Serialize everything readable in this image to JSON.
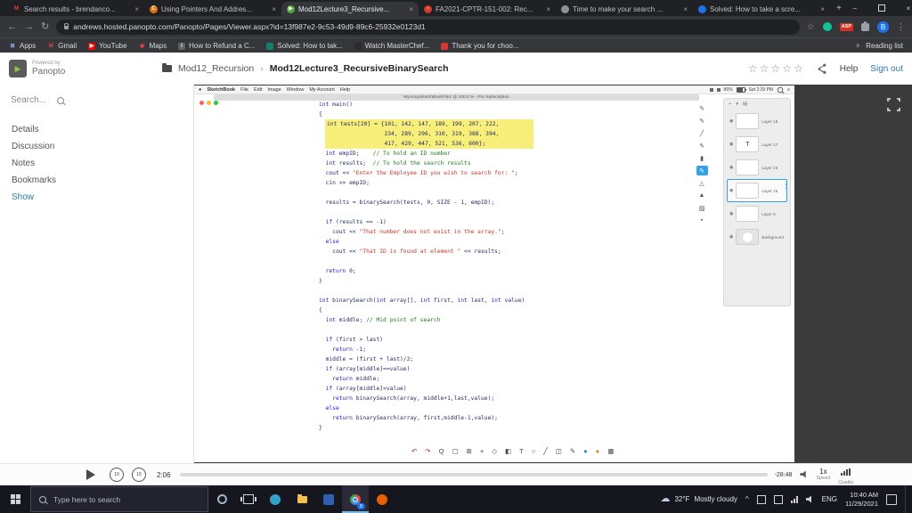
{
  "browser": {
    "tabs": [
      {
        "title": "Search results - brendanco...",
        "fav": {
          "bg": "transparent",
          "fg": "#ea4335",
          "g": "M"
        },
        "active": false
      },
      {
        "title": "Using Pointers And Addres...",
        "fav": {
          "bg": "#e8710a",
          "fg": "#ffffff",
          "g": "C"
        },
        "active": false
      },
      {
        "title": "Mod12Lecture3_Recursive...",
        "fav": {
          "bg": "#4ea93b",
          "fg": "#ffffff",
          "g": "▶"
        },
        "active": true
      },
      {
        "title": "FA2021-CPTR-151-002: Rec...",
        "fav": {
          "bg": "#d0382e",
          "fg": "#ffffff",
          "g": "○"
        },
        "active": false
      },
      {
        "title": "Time to make your search ...",
        "fav": {
          "bg": "#8d9297",
          "fg": "#ffffff",
          "g": ""
        },
        "active": false
      },
      {
        "title": "Solved: How to take a scre...",
        "fav": {
          "bg": "#1a73e8",
          "fg": "#ffffff",
          "g": ""
        },
        "active": false
      }
    ],
    "new_tab": "+",
    "window_controls": {
      "minimize": "–",
      "close": "×"
    },
    "nav": {
      "back": "←",
      "forward": "→",
      "reload": "↻"
    },
    "url": "andrews.hosted.panopto.com/Panopto/Pages/Viewer.aspx?id=13f987e2-9c53-49d9-89c6-25932e0123d1",
    "extensions_badge": "ASP",
    "profile_initial": "B",
    "menu_glyph": "⋮",
    "bookmarks": [
      {
        "label": "Apps",
        "fav": {
          "bg": "transparent",
          "fg": "#8ab4f8",
          "g": "⊞"
        }
      },
      {
        "label": "Gmail",
        "fav": {
          "bg": "transparent",
          "fg": "#ea4335",
          "g": "M"
        }
      },
      {
        "label": "YouTube",
        "fav": {
          "bg": "#ff0000",
          "fg": "#ffffff",
          "g": "▶"
        }
      },
      {
        "label": "Maps",
        "fav": {
          "bg": "transparent",
          "fg": "#ea4335",
          "g": "◉"
        }
      },
      {
        "label": "How to Refund a C...",
        "fav": {
          "bg": "#5f6368",
          "fg": "#ffffff",
          "g": "i"
        }
      },
      {
        "label": "Solved: How to tak...",
        "fav": {
          "bg": "#12806a",
          "fg": "#ffffff",
          "g": ""
        }
      },
      {
        "label": "Watch MasterChef...",
        "fav": {
          "bg": "#2b2b2b",
          "fg": "#ffffff",
          "g": ""
        }
      },
      {
        "label": "Thank you for choo...",
        "fav": {
          "bg": "#d63a2f",
          "fg": "#ffffff",
          "g": ""
        }
      }
    ],
    "reading_list": "Reading list"
  },
  "panopto": {
    "powered_by": "Powered by",
    "brand": "Panopto",
    "breadcrumb_folder": "Mod12_Recursion",
    "breadcrumb_sep": "›",
    "breadcrumb_title": "Mod12Lecture3_RecursiveBinarySearch",
    "stars_count": 5,
    "star_glyph": "☆",
    "help": "Help",
    "sign_out": "Sign out",
    "sidebar": {
      "search": "Search...",
      "items": [
        {
          "label": "Details"
        },
        {
          "label": "Discussion"
        },
        {
          "label": "Notes"
        },
        {
          "label": "Bookmarks"
        },
        {
          "label": "Show",
          "accent": true
        }
      ]
    },
    "controls": {
      "rewind": "10",
      "forward": "15",
      "current": "2:06",
      "remaining": "-28:48",
      "progress_pct": 9,
      "speed_value": "1x",
      "speed_label": "Speed",
      "quality_label": "Quality"
    }
  },
  "mac": {
    "apple_glyph": "●",
    "app_name": "SketchBook",
    "menus": [
      "File",
      "Edit",
      "Image",
      "Window",
      "My Account",
      "Help"
    ],
    "battery": "86%",
    "clock": "Sat 2:29 PM",
    "menu_list_glyph": "≡",
    "notification": "MyArraySketchBookFile1 @ 100.0 % - Pro Subscription",
    "tools": [
      {
        "name": "pencil-tool-icon",
        "g": "✎"
      },
      {
        "name": "pen-tool-icon",
        "g": "✎"
      },
      {
        "name": "line-tool-icon",
        "g": "╱"
      },
      {
        "name": "brush-tool-icon",
        "g": "✎"
      },
      {
        "name": "marker-tool-icon",
        "g": "▮"
      },
      {
        "name": "airbrush-tool-icon",
        "g": "✎",
        "sel": true
      },
      {
        "name": "triangle-ruler-icon",
        "g": "△"
      },
      {
        "name": "triangle-tool-icon",
        "g": "▲"
      },
      {
        "name": "shape-tool-icon",
        "g": "▨"
      },
      {
        "name": "swatch-tool-icon",
        "g": "▪"
      }
    ],
    "layers_header": [
      {
        "name": "add-layer-icon",
        "g": "+"
      },
      {
        "name": "layer-menu-icon",
        "g": "▾"
      },
      {
        "name": "layer-group-icon",
        "g": "▤"
      }
    ],
    "layers": [
      {
        "label": "Layer 18",
        "type": "normal"
      },
      {
        "label": "Layer 17",
        "type": "text"
      },
      {
        "label": "Layer 16",
        "type": "normal"
      },
      {
        "label": "Layer 15",
        "type": "normal",
        "selected": true
      },
      {
        "label": "Layer 6",
        "type": "normal"
      },
      {
        "label": "Background",
        "type": "background"
      }
    ],
    "bottom_tools": [
      {
        "name": "undo-icon",
        "g": "↶",
        "c": "#9c3b2e"
      },
      {
        "name": "redo-icon",
        "g": "↷",
        "c": "#9c3b2e"
      },
      {
        "name": "zoom-tool-icon",
        "g": "Q",
        "c": "#4a4a4a"
      },
      {
        "name": "selection-tool-icon",
        "g": "▢",
        "c": "#4a4a4a"
      },
      {
        "name": "crop-tool-icon",
        "g": "⊞",
        "c": "#4a4a4a"
      },
      {
        "name": "transform-tool-icon",
        "g": "+",
        "c": "#4a4a4a"
      },
      {
        "name": "distort-tool-icon",
        "g": "◇",
        "c": "#4a4a4a"
      },
      {
        "name": "fill-tool-icon",
        "g": "◧",
        "c": "#4a4a4a"
      },
      {
        "name": "text-tool-icon",
        "g": "T",
        "c": "#4a4a4a"
      },
      {
        "name": "shapes-tool-icon",
        "g": "○",
        "c": "#4a4a4a"
      },
      {
        "name": "ruler-tool-icon",
        "g": "╱",
        "c": "#4a4a4a"
      },
      {
        "name": "symmetry-tool-icon",
        "g": "◫",
        "c": "#4a4a4a"
      },
      {
        "name": "pencil-mark-icon",
        "g": "✎",
        "c": "#4a4a4a"
      },
      {
        "name": "color-puck-icon",
        "g": "●",
        "c": "#2e86c1"
      },
      {
        "name": "brush-puck-icon",
        "g": "●",
        "c": "#e67e22"
      },
      {
        "name": "canvas-grid-icon",
        "g": "▦",
        "c": "#4a4a4a"
      }
    ],
    "code": [
      {
        "s": [
          [
            "k",
            "int"
          ],
          [
            "d",
            " main()"
          ]
        ]
      },
      {
        "s": [
          [
            "d",
            "{"
          ]
        ]
      },
      {
        "hl": true,
        "s": [
          [
            "d",
            "int tests[20] = {101, 142, 147, 189, 199, 207, 222,"
          ]
        ]
      },
      {
        "hl": true,
        "s": [
          [
            "d",
            "                 234, 289, 296, 310, 319, 388, 394,"
          ]
        ]
      },
      {
        "hl": true,
        "s": [
          [
            "d",
            "                 417, 429, 447, 521, 536, 600};"
          ]
        ]
      },
      {
        "s": [
          [
            "d",
            "  "
          ],
          [
            "k",
            "int"
          ],
          [
            "d",
            " empID;    "
          ],
          [
            "c",
            "// To hold an ID number"
          ]
        ]
      },
      {
        "s": [
          [
            "d",
            "  "
          ],
          [
            "k",
            "int"
          ],
          [
            "d",
            " results;  "
          ],
          [
            "c",
            "// To hold the search results"
          ]
        ]
      },
      {
        "s": [
          [
            "d",
            "  cout << "
          ],
          [
            "s2",
            "\"Enter the Employee ID you wish to search for: \""
          ],
          [
            "d",
            ";"
          ]
        ]
      },
      {
        "s": [
          [
            "d",
            "  cin >> empID;"
          ]
        ]
      },
      {},
      {
        "s": [
          [
            "d",
            "  results = binarySearch(tests, 0, SIZE - 1, empID);"
          ]
        ]
      },
      {},
      {
        "s": [
          [
            "d",
            "  "
          ],
          [
            "k",
            "if"
          ],
          [
            "d",
            " (results == -1)"
          ]
        ]
      },
      {
        "s": [
          [
            "d",
            "    cout << "
          ],
          [
            "s2",
            "\"That number does not exist in the array.\""
          ],
          [
            "d",
            ";"
          ]
        ]
      },
      {
        "s": [
          [
            "d",
            "  "
          ],
          [
            "k",
            "else"
          ]
        ]
      },
      {
        "s": [
          [
            "d",
            "    cout << "
          ],
          [
            "s2",
            "\"That ID is found at element \""
          ],
          [
            "d",
            " << results;"
          ]
        ]
      },
      {},
      {
        "s": [
          [
            "d",
            "  "
          ],
          [
            "k",
            "return"
          ],
          [
            "d",
            " 0;"
          ]
        ]
      },
      {
        "s": [
          [
            "d",
            "}"
          ]
        ]
      },
      {},
      {
        "s": [
          [
            "k",
            "int"
          ],
          [
            "d",
            " binarySearch("
          ],
          [
            "k",
            "int"
          ],
          [
            "d",
            " array[], "
          ],
          [
            "k",
            "int"
          ],
          [
            "d",
            " first, "
          ],
          [
            "k",
            "int"
          ],
          [
            "d",
            " last, "
          ],
          [
            "k",
            "int"
          ],
          [
            "d",
            " value)"
          ]
        ]
      },
      {
        "s": [
          [
            "d",
            "{"
          ]
        ]
      },
      {
        "s": [
          [
            "d",
            "  "
          ],
          [
            "k",
            "int"
          ],
          [
            "d",
            " middle; "
          ],
          [
            "c",
            "// Mid point of search"
          ]
        ]
      },
      {},
      {
        "s": [
          [
            "d",
            "  "
          ],
          [
            "k",
            "if"
          ],
          [
            "d",
            " (first > last)"
          ]
        ]
      },
      {
        "s": [
          [
            "d",
            "    "
          ],
          [
            "k",
            "return"
          ],
          [
            "d",
            " -1;"
          ]
        ]
      },
      {
        "s": [
          [
            "d",
            "  middle = (first + last)/2;"
          ]
        ]
      },
      {
        "s": [
          [
            "d",
            "  "
          ],
          [
            "k",
            "if"
          ],
          [
            "d",
            " (array[middle]==value)"
          ]
        ]
      },
      {
        "s": [
          [
            "d",
            "    "
          ],
          [
            "k",
            "return"
          ],
          [
            "d",
            " middle;"
          ]
        ]
      },
      {
        "s": [
          [
            "d",
            "  "
          ],
          [
            "k",
            "if"
          ],
          [
            "d",
            " (array[middle]<value)"
          ]
        ]
      },
      {
        "s": [
          [
            "d",
            "    "
          ],
          [
            "k",
            "return"
          ],
          [
            "d",
            " binarySearch(array, middle+1,last,value);"
          ]
        ]
      },
      {
        "s": [
          [
            "d",
            "  "
          ],
          [
            "k",
            "else"
          ]
        ]
      },
      {
        "s": [
          [
            "d",
            "    "
          ],
          [
            "k",
            "return"
          ],
          [
            "d",
            " binarySearch(array, first,middle-1,value);"
          ]
        ]
      },
      {
        "s": [
          [
            "d",
            "}"
          ]
        ]
      }
    ]
  },
  "taskbar": {
    "search_placeholder": "Type here to search",
    "icons": [
      {
        "name": "cortana-icon",
        "type": "ring"
      },
      {
        "name": "task-view-icon",
        "type": "taskview"
      },
      {
        "name": "edge-icon",
        "type": "circle",
        "color": "#35a3c8"
      },
      {
        "name": "file-explorer-icon",
        "type": "folder"
      },
      {
        "name": "store-icon",
        "type": "square",
        "color": "#2f5fb3"
      },
      {
        "name": "chrome-icon",
        "type": "chrome",
        "active": true,
        "badge": "8"
      },
      {
        "name": "firefox-icon",
        "type": "circle",
        "color": "#e66000"
      }
    ],
    "weather_temp": "32°F",
    "weather_desc": "Mostly cloudy",
    "lang": "ENG",
    "time": "10:40 AM",
    "date": "11/29/2021"
  }
}
